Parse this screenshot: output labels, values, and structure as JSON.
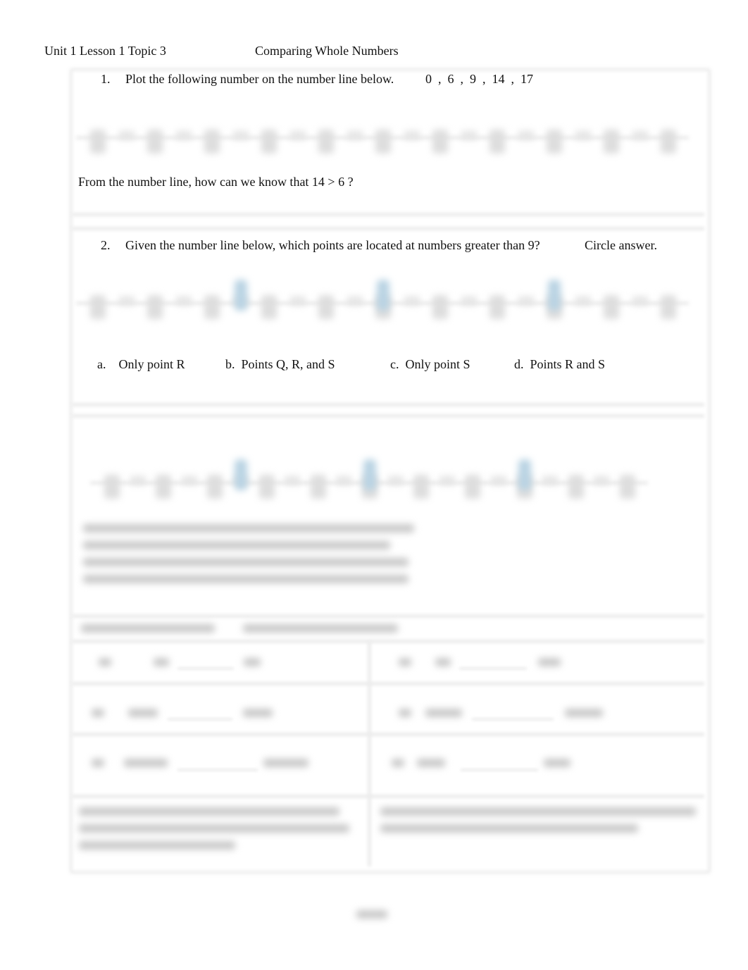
{
  "header": {
    "unit": "Unit 1 Lesson 1 Topic 3",
    "title": "Comparing Whole Numbers"
  },
  "q1": {
    "number": "1.",
    "prompt": "Plot the following number on the number line below.",
    "values": "0  ,  6  ,  9  ,  14  ,  17",
    "followup": "From the number line, how can we know that 14 > 6 ?"
  },
  "q2": {
    "number": "2.",
    "prompt": "Given the number line below, which points are located at numbers greater than 9?",
    "instruction": "Circle answer.",
    "choices": [
      {
        "letter": "a.",
        "text": "Only point R"
      },
      {
        "letter": "b.",
        "text": "Points Q, R, and S"
      },
      {
        "letter": "c.",
        "text": "Only point S"
      },
      {
        "letter": "d.",
        "text": "Points R and S"
      }
    ]
  },
  "colors": {
    "point_highlight": "#b9d3e3",
    "border": "#eeeeee"
  }
}
